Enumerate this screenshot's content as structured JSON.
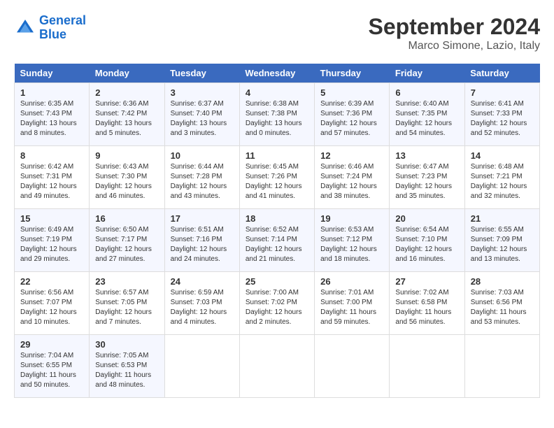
{
  "logo": {
    "line1": "General",
    "line2": "Blue"
  },
  "title": "September 2024",
  "subtitle": "Marco Simone, Lazio, Italy",
  "days_of_week": [
    "Sunday",
    "Monday",
    "Tuesday",
    "Wednesday",
    "Thursday",
    "Friday",
    "Saturday"
  ],
  "weeks": [
    [
      {
        "day": "1",
        "sunrise": "6:35 AM",
        "sunset": "7:43 PM",
        "daylight": "13 hours and 8 minutes."
      },
      {
        "day": "2",
        "sunrise": "6:36 AM",
        "sunset": "7:42 PM",
        "daylight": "13 hours and 5 minutes."
      },
      {
        "day": "3",
        "sunrise": "6:37 AM",
        "sunset": "7:40 PM",
        "daylight": "13 hours and 3 minutes."
      },
      {
        "day": "4",
        "sunrise": "6:38 AM",
        "sunset": "7:38 PM",
        "daylight": "13 hours and 0 minutes."
      },
      {
        "day": "5",
        "sunrise": "6:39 AM",
        "sunset": "7:36 PM",
        "daylight": "12 hours and 57 minutes."
      },
      {
        "day": "6",
        "sunrise": "6:40 AM",
        "sunset": "7:35 PM",
        "daylight": "12 hours and 54 minutes."
      },
      {
        "day": "7",
        "sunrise": "6:41 AM",
        "sunset": "7:33 PM",
        "daylight": "12 hours and 52 minutes."
      }
    ],
    [
      {
        "day": "8",
        "sunrise": "6:42 AM",
        "sunset": "7:31 PM",
        "daylight": "12 hours and 49 minutes."
      },
      {
        "day": "9",
        "sunrise": "6:43 AM",
        "sunset": "7:30 PM",
        "daylight": "12 hours and 46 minutes."
      },
      {
        "day": "10",
        "sunrise": "6:44 AM",
        "sunset": "7:28 PM",
        "daylight": "12 hours and 43 minutes."
      },
      {
        "day": "11",
        "sunrise": "6:45 AM",
        "sunset": "7:26 PM",
        "daylight": "12 hours and 41 minutes."
      },
      {
        "day": "12",
        "sunrise": "6:46 AM",
        "sunset": "7:24 PM",
        "daylight": "12 hours and 38 minutes."
      },
      {
        "day": "13",
        "sunrise": "6:47 AM",
        "sunset": "7:23 PM",
        "daylight": "12 hours and 35 minutes."
      },
      {
        "day": "14",
        "sunrise": "6:48 AM",
        "sunset": "7:21 PM",
        "daylight": "12 hours and 32 minutes."
      }
    ],
    [
      {
        "day": "15",
        "sunrise": "6:49 AM",
        "sunset": "7:19 PM",
        "daylight": "12 hours and 29 minutes."
      },
      {
        "day": "16",
        "sunrise": "6:50 AM",
        "sunset": "7:17 PM",
        "daylight": "12 hours and 27 minutes."
      },
      {
        "day": "17",
        "sunrise": "6:51 AM",
        "sunset": "7:16 PM",
        "daylight": "12 hours and 24 minutes."
      },
      {
        "day": "18",
        "sunrise": "6:52 AM",
        "sunset": "7:14 PM",
        "daylight": "12 hours and 21 minutes."
      },
      {
        "day": "19",
        "sunrise": "6:53 AM",
        "sunset": "7:12 PM",
        "daylight": "12 hours and 18 minutes."
      },
      {
        "day": "20",
        "sunrise": "6:54 AM",
        "sunset": "7:10 PM",
        "daylight": "12 hours and 16 minutes."
      },
      {
        "day": "21",
        "sunrise": "6:55 AM",
        "sunset": "7:09 PM",
        "daylight": "12 hours and 13 minutes."
      }
    ],
    [
      {
        "day": "22",
        "sunrise": "6:56 AM",
        "sunset": "7:07 PM",
        "daylight": "12 hours and 10 minutes."
      },
      {
        "day": "23",
        "sunrise": "6:57 AM",
        "sunset": "7:05 PM",
        "daylight": "12 hours and 7 minutes."
      },
      {
        "day": "24",
        "sunrise": "6:59 AM",
        "sunset": "7:03 PM",
        "daylight": "12 hours and 4 minutes."
      },
      {
        "day": "25",
        "sunrise": "7:00 AM",
        "sunset": "7:02 PM",
        "daylight": "12 hours and 2 minutes."
      },
      {
        "day": "26",
        "sunrise": "7:01 AM",
        "sunset": "7:00 PM",
        "daylight": "11 hours and 59 minutes."
      },
      {
        "day": "27",
        "sunrise": "7:02 AM",
        "sunset": "6:58 PM",
        "daylight": "11 hours and 56 minutes."
      },
      {
        "day": "28",
        "sunrise": "7:03 AM",
        "sunset": "6:56 PM",
        "daylight": "11 hours and 53 minutes."
      }
    ],
    [
      {
        "day": "29",
        "sunrise": "7:04 AM",
        "sunset": "6:55 PM",
        "daylight": "11 hours and 50 minutes."
      },
      {
        "day": "30",
        "sunrise": "7:05 AM",
        "sunset": "6:53 PM",
        "daylight": "11 hours and 48 minutes."
      },
      null,
      null,
      null,
      null,
      null
    ]
  ],
  "labels": {
    "sunrise": "Sunrise:",
    "sunset": "Sunset:",
    "daylight": "Daylight:"
  }
}
